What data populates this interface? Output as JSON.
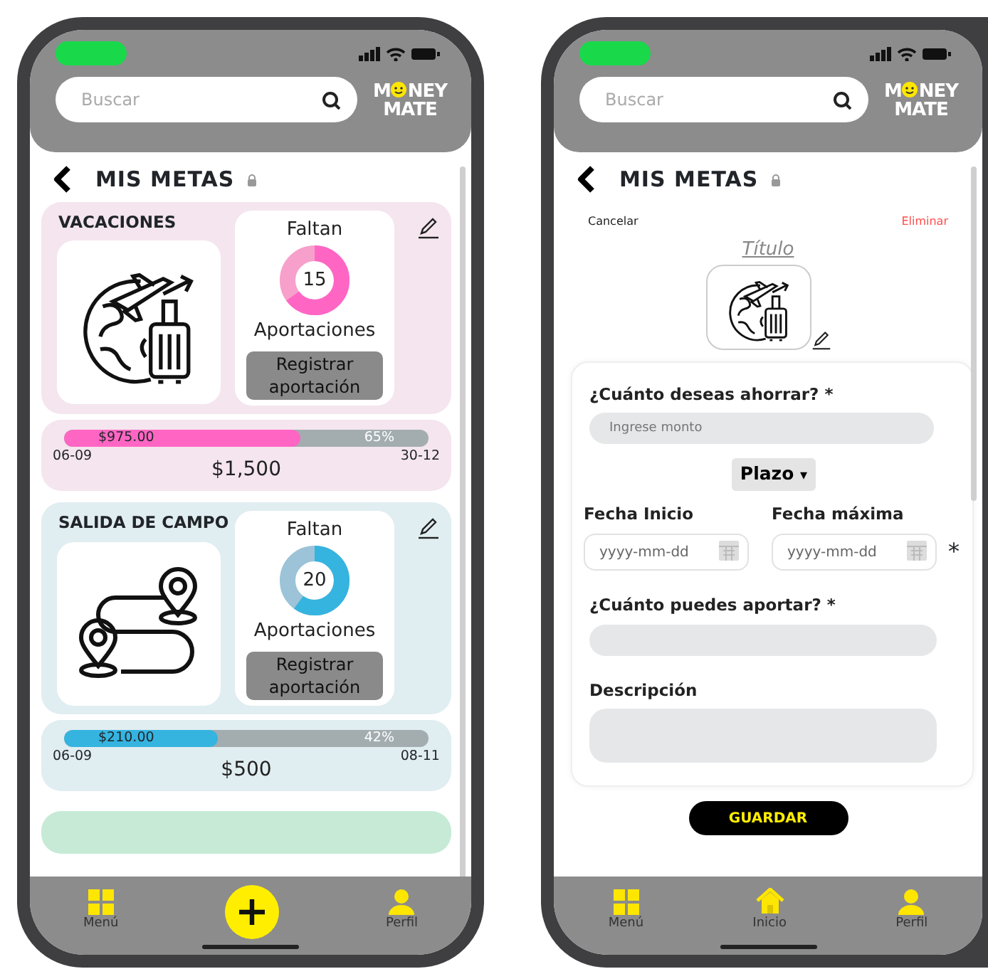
{
  "phones": [
    {
      "kind": "goals_list",
      "header": {
        "search_placeholder": "Buscar",
        "logo": {
          "start": "M",
          "end": "NEY",
          "line2": "MATE"
        }
      },
      "title": "MIS METAS",
      "goals": [
        {
          "name": "VACACIONES",
          "illustration": {
            "kind": "travel"
          },
          "color": "#ff66c4",
          "remaining_label": "Faltan",
          "remaining": "15",
          "ring": {
            "level": 0.65
          },
          "unit_label": "Aportaciones",
          "button": "Registrar aportación",
          "progress": {
            "level": 0.65,
            "saved": "$975.00",
            "percent": "65%",
            "start": "06-09",
            "end": "30-12",
            "goal": "$1,500"
          }
        },
        {
          "name": "SALIDA DE CAMPO",
          "illustration": {
            "kind": "route"
          },
          "color": "#35b4e0",
          "remaining_label": "Faltan",
          "remaining": "20",
          "ring": {
            "level": 0.6
          },
          "unit_label": "Aportaciones",
          "button": "Registrar aportación",
          "progress": {
            "level": 0.42,
            "saved": "$210.00",
            "percent": "42%",
            "start": "06-09",
            "end": "08-11",
            "goal": "$500"
          }
        }
      ],
      "next_goal_peek": {
        "color": "#c6ead6"
      },
      "nav": [
        {
          "kind": "menu",
          "label": "Menú"
        },
        {
          "kind": "add"
        },
        {
          "kind": "profile",
          "label": "Perfil"
        }
      ]
    },
    {
      "kind": "goal_form",
      "header": {
        "search_placeholder": "Buscar",
        "logo": {
          "start": "M",
          "end": "NEY",
          "line2": "MATE"
        }
      },
      "title": "MIS METAS",
      "cancel": "Cancelar",
      "delete": "Eliminar",
      "goal_title": "Título",
      "illustration": {
        "kind": "travel"
      },
      "amount": {
        "label": "¿Cuánto deseas ahorrar? *",
        "placeholder": "Ingrese monto"
      },
      "term_select": {
        "label": "Plazo",
        "caret": "▾"
      },
      "dates": [
        {
          "label": "Fecha Inicio",
          "placeholder": "yyyy-mm-dd"
        },
        {
          "label": "Fecha máxima",
          "placeholder": "yyyy-mm-dd"
        }
      ],
      "date_mark": "*",
      "contribution": {
        "label": "¿Cuánto puedes aportar? *"
      },
      "description": {
        "label": "Descripción"
      },
      "save_button": "GUARDAR",
      "nav": [
        {
          "kind": "menu",
          "label": "Menú"
        },
        {
          "kind": "home",
          "label": "Inicio"
        },
        {
          "kind": "profile",
          "label": "Perfil"
        }
      ]
    }
  ]
}
